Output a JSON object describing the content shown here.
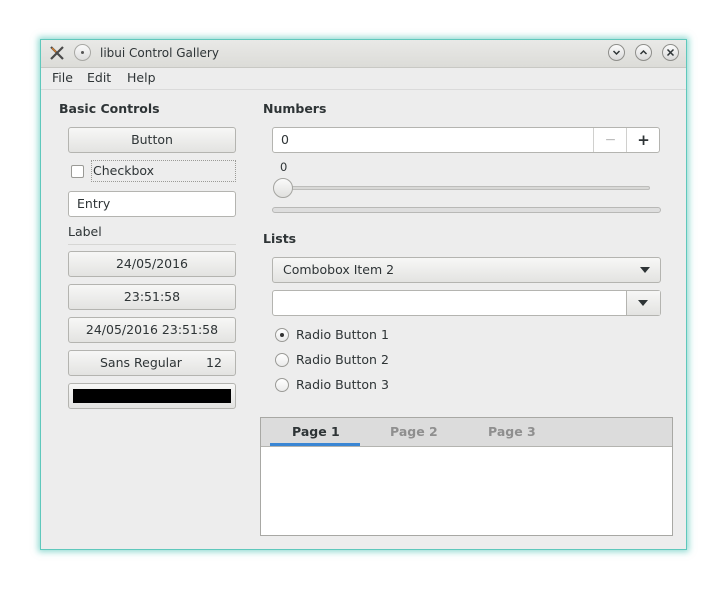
{
  "window": {
    "title": "libui Control Gallery"
  },
  "menubar": {
    "items": [
      "File",
      "Edit",
      "Help"
    ]
  },
  "basic": {
    "title": "Basic Controls",
    "button_label": "Button",
    "checkbox_label": "Checkbox",
    "entry_value": "Entry",
    "label_text": "Label",
    "date_value": "24/05/2016",
    "time_value": "23:51:58",
    "datetime_value": "24/05/2016 23:51:58",
    "font_name": "Sans Regular",
    "font_size": "12",
    "color": "#000000"
  },
  "numbers": {
    "title": "Numbers",
    "spinbox_value": "0",
    "minus_label": "−",
    "plus_label": "+",
    "slider_value": "0",
    "progress": 0
  },
  "lists": {
    "title": "Lists",
    "combobox_selected": "Combobox Item 2",
    "editable_combobox_value": "",
    "radios": [
      {
        "label": "Radio Button 1",
        "checked": true
      },
      {
        "label": "Radio Button 2",
        "checked": false
      },
      {
        "label": "Radio Button 3",
        "checked": false
      }
    ]
  },
  "tabs": {
    "items": [
      {
        "label": "Page 1",
        "active": true
      },
      {
        "label": "Page 2",
        "active": false
      },
      {
        "label": "Page 3",
        "active": false
      }
    ]
  },
  "colors": {
    "accent": "#3a86d4",
    "window_glow": "#5fc8bc"
  },
  "icons": [
    "app-icon",
    "window-menu-icon",
    "minimize-icon",
    "maximize-icon",
    "close-icon",
    "dropdown-arrow-icon"
  ]
}
